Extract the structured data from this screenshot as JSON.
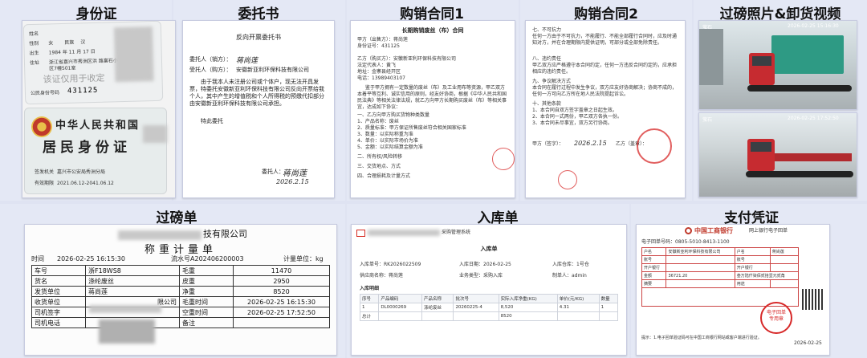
{
  "titles": {
    "id_card": "身份证",
    "entrust": "委托书",
    "contract1": "购销合同1",
    "contract2": "购销合同2",
    "photos": "过磅照片&卸货视频",
    "weigh": "过磅单",
    "warehouse": "入库单",
    "payment": "支付凭证"
  },
  "id_card": {
    "front_labels": [
      "姓名",
      "性别",
      "出生",
      "住址",
      "公民身份号码"
    ],
    "sex": "女",
    "ethnic_label": "民族",
    "ethnic": "汉",
    "birth": "1984 年 11 月 17 日",
    "address": "浙江省嘉兴市秀洲区洪 路富石小区7幢501室",
    "watermark": "该证仅用于收定",
    "id_number": "431125",
    "back_title1": "中华人民共和国",
    "back_title2": "居民身份证",
    "authority_label": "签发机关",
    "authority": "嘉兴市公安局秀洲分局",
    "validity_label": "有效期限",
    "validity": "2021.06.12-2041.06.12"
  },
  "entrust": {
    "heading": "反向开票委托书",
    "principal_label": "委托人（销方）：",
    "principal_sig": "蒋尚莲",
    "agent_label": "受托人（购方）：",
    "agent": "安徽新亚利环保科技有限公司",
    "body": "由于我本人未注册公司或个体户，现无法开具发票，特委托安徽新亚利环保科技有限公司反向开票给我个人，其中产生的增值税和个人所得税的预缴代扣部分由安徽新亚利环保科技有限公司承担。",
    "closing": "特此委托",
    "sign_label": "委托人：",
    "sign_name": "蒋尚莲",
    "sign_date": "2026.2.15"
  },
  "contract1": {
    "heading": "长期购销废丝（布）合同",
    "party_a": "甲方（出售方）：蒋尚莲",
    "party_a_id": "身份证号：431125",
    "party_b": "乙方（购买方）：安徽新亚利环保科技有限公司",
    "legal": "法定代表人：黄飞",
    "address": "地址：金寨县经开区",
    "phone": "电话：13989403107",
    "body": "鉴于甲方拥有一定数量的废丝（布）及工业用布等资源，甲乙双方本着平等互利、诚实信用的原则，经友好协商，根据《中华人民共和国民法典》等相关法律法规，就乙方向甲方长期购买废丝（布）等相关事宜，达成如下协议：",
    "sec1": "一、乙方向甲方购买货物种类数量",
    "items": [
      "1、产品名称：废丝",
      "2、质量标准：甲方保证所售废丝符合相关国家标准",
      "3、数量：以实际称重为准",
      "4、单价：以实际市场价为准",
      "5、金额：以实际结算金额为准"
    ],
    "sec2": "二、所有权/风险转移",
    "sec3": "三、交货地点、方式",
    "sec4": "四、合理损耗及计量方式"
  },
  "contract2": {
    "sections": [
      "七、不可抗力",
      "八、违约责任",
      "九、争议解决方式",
      "十、其他条款"
    ],
    "body1": "任何一方由于不可抗力，不能履行、不能全部履行合同时，应及时通知对方，并在合理期限内提供证明，可部分或全部免除责任。",
    "body2": "甲乙双方应严格遵守本合同约定，任何一方违反合同约定的，应承担相应的违约责任。",
    "body3": "本合同在履行过程中发生争议，双方应友好协商解决；协商不成的，任何一方可向乙方所在地人民法院提起诉讼。",
    "clauses": [
      "1、本合同自双方签字盖章之日起生效。",
      "2、本合同一式两份，甲乙双方各执一份。",
      "3、本合同未尽事宜，双方另行协商。"
    ],
    "sign_a": "甲方（签字）：",
    "sign_b": "乙方（盖章）：",
    "date": "2026.2.15"
  },
  "photos": {
    "cam_brand": "萤石",
    "timestamp1": "2026-02-25 15:16:30",
    "timestamp2": "2026-02-25 17:52:50"
  },
  "weigh": {
    "company": "技有限公司",
    "heading": "称重计量单",
    "time_label": "时间",
    "time": "2026-02-25 16:15:30",
    "serial_label": "流水号",
    "serial": "A202406200003",
    "unit_label": "计量单位：kg",
    "rows": [
      [
        "车号",
        "浙F18WS8",
        "毛重",
        "11470"
      ],
      [
        "货名",
        "涤纶废丝",
        "皮重",
        "2950"
      ],
      [
        "发货单位",
        "蒋尚莲",
        "净重",
        "8520"
      ],
      [
        "收货单位",
        "限公司",
        "毛重时间",
        "2026-02-25 16:15:30"
      ],
      [
        "司机签字",
        "",
        "空重时间",
        "2026-02-25 17:52:50"
      ],
      [
        "司机电话",
        "",
        "备注",
        ""
      ]
    ]
  },
  "warehouse": {
    "system": "采购管理系统",
    "heading": "入库单",
    "fields": [
      "入库单号：RK2026022509",
      "入库日期：2026-02-25",
      "入库仓库：1号仓",
      "供应商名称：蒋尚莲",
      "业务类型：采购入库",
      "制单人：admin"
    ],
    "detail_title": "入库明细",
    "columns": [
      "序号",
      "产品编码",
      "产品名称",
      "批次号",
      "实际入库净重(KG)",
      "单价(元/KG)",
      "数量"
    ],
    "row": [
      "1",
      "DL0000269",
      "涤纶废丝",
      "20260225-4",
      "8,520",
      "4.31",
      "1"
    ],
    "total_label": "总计",
    "total": "8520"
  },
  "payment": {
    "bank": "中国工商银行",
    "doc_title": "网上银行电子回单",
    "receipt_no": "电子回单号码：0805-5010-8413-1100",
    "labels": [
      "户名",
      "账号",
      "开户银行",
      "金额",
      "摘要",
      "用途"
    ],
    "payer": "安徽新亚利环保科技有限公司",
    "payee": "蒋尚莲",
    "amount": "36721.20",
    "amount_cn": "叁万陆仟柒佰贰拾壹元贰角",
    "stamp_top": "电子回单",
    "stamp_bottom": "专用章",
    "date": "2026-02-25",
    "footer": "提示：1.电子回单验证码可在中国工商银行网站或客户端进行验证。"
  },
  "colors": {
    "background": "#dfe3f2",
    "seal": "#d72828",
    "bank_red": "#c0392b"
  }
}
